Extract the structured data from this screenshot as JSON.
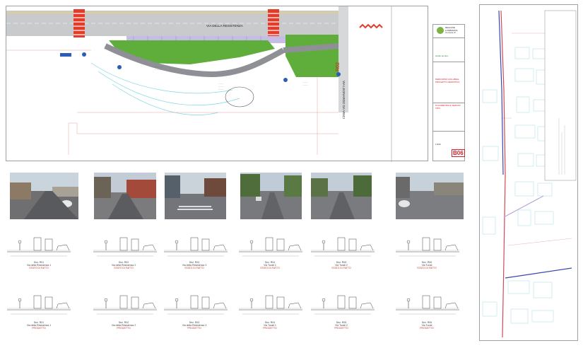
{
  "plan": {
    "street_main": "VIA DELLA RESISTENZA",
    "street_side": "VIA LEONARDO DA VINCI",
    "area_code": "R02",
    "sheet_number": "B06"
  },
  "titleblock": {
    "logo_text": "REGIONE LOMBARDIA",
    "logo_sub": "Comune di",
    "company": "studio tecnico",
    "project_line": "PERCORSO CICLABILE",
    "stage": "PROGETTO DEFINITIVO",
    "sheet_title": "PLANIMETRIA E SEZIONI TIPO",
    "scale": "1:500",
    "code": "B06"
  },
  "sections": [
    {
      "id": "Sez. R01",
      "street": "Via della Resistenza 1",
      "existing": "STATO DI FATTO",
      "project": "PROGETTO"
    },
    {
      "id": "Sez. R02",
      "street": "Via della Resistenza 2",
      "existing": "STATO DI FATTO",
      "project": "PROGETTO"
    },
    {
      "id": "Sez. R03",
      "street": "Via della Resistenza 3",
      "existing": "STATO DI FATTO",
      "project": "PROGETTO"
    },
    {
      "id": "Sez. R04",
      "street": "Via Turati 1",
      "existing": "STATO DI FATTO",
      "project": "PROGETTO"
    },
    {
      "id": "Sez. R05",
      "street": "Via Turati 2",
      "existing": "STATO DI FATTO",
      "project": "PROGETTO"
    },
    {
      "id": "Sez. R06",
      "street": "Via Turati",
      "existing": "STATO DI FATTO",
      "project": "PROGETTO"
    }
  ],
  "colors": {
    "road_gray": "#8e9095",
    "green": "#5fae3b",
    "bike_purple": "#b7a8d8",
    "crossing_red": "#e23c2b",
    "blue_sign": "#2b5db8",
    "route_red": "#d04a5a",
    "route_blue": "#3a46b0"
  }
}
